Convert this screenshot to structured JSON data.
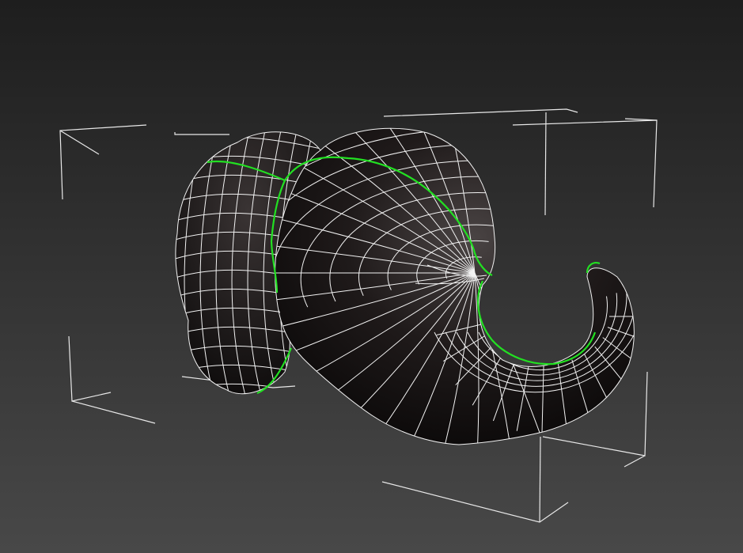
{
  "viewport": {
    "bg_top": "#1e1e1e",
    "bg_bottom": "#484848"
  },
  "scene": {
    "object": "elephant-head-mesh",
    "wire_color": "#f2f2f2",
    "seam_color": "#22e022",
    "shade_dark": "#0d0b0b",
    "shade_light": "#4a4444",
    "bbox_color": "#e8e8e8"
  }
}
